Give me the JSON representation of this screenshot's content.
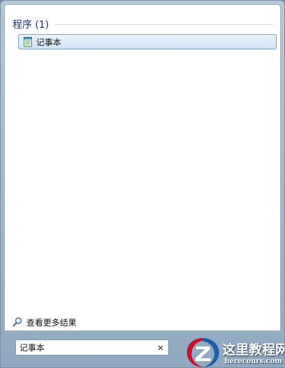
{
  "results": {
    "group_title": "程序 (1)",
    "items": [
      {
        "label": "记事本",
        "icon": "notepad-icon"
      }
    ],
    "see_more_label": "查看更多结果",
    "see_more_icon": "search-icon"
  },
  "search": {
    "value": "记事本",
    "clear_icon": "close-icon"
  },
  "watermark": {
    "title": "这里教程网",
    "url": "herecours.com"
  },
  "colors": {
    "group_title": "#1e3287",
    "selection_border": "#7da2ce",
    "frame": "#b7c8d8",
    "watermark_red": "#c8102e",
    "watermark_blue": "#1f5fa8"
  }
}
